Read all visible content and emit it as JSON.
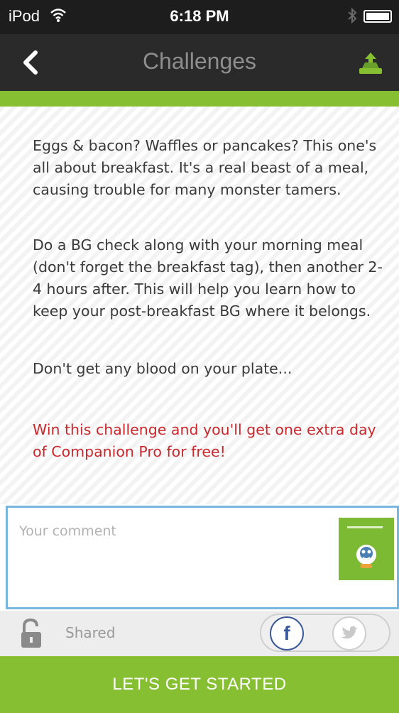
{
  "status_bar": {
    "carrier": "iPod",
    "time": "6:18 PM",
    "wifi_icon": "wifi-icon",
    "bluetooth_icon": "bluetooth-icon",
    "battery_icon": "battery-icon"
  },
  "navbar": {
    "back_icon": "chevron-left-icon",
    "title": "Challenges",
    "upload_icon": "upload-icon"
  },
  "challenge": {
    "paragraphs": [
      "Eggs & bacon? Waffles or pancakes? This one's all about breakfast. It's a real beast of a meal, causing trouble for many monster tamers.",
      "Do a BG check along with your morning meal (don't forget the breakfast tag), then another 2-4 hours after. This will help you learn how to keep your post-breakfast BG where it belongs.",
      "Don't get any blood on your plate..."
    ],
    "promo": "Win this challenge and you'll get one extra day of Companion Pro for free!"
  },
  "comment": {
    "placeholder": "Your comment",
    "badge_icon": "challenge-badge-icon"
  },
  "share": {
    "lock_icon": "lock-icon",
    "label": "Shared",
    "facebook_icon": "facebook-icon",
    "facebook_glyph": "f",
    "twitter_icon": "twitter-icon"
  },
  "cta": {
    "label": "LET'S GET STARTED"
  },
  "colors": {
    "accent_green": "#86bf32",
    "promo_red": "#c9282d",
    "input_border": "#78b6de"
  }
}
